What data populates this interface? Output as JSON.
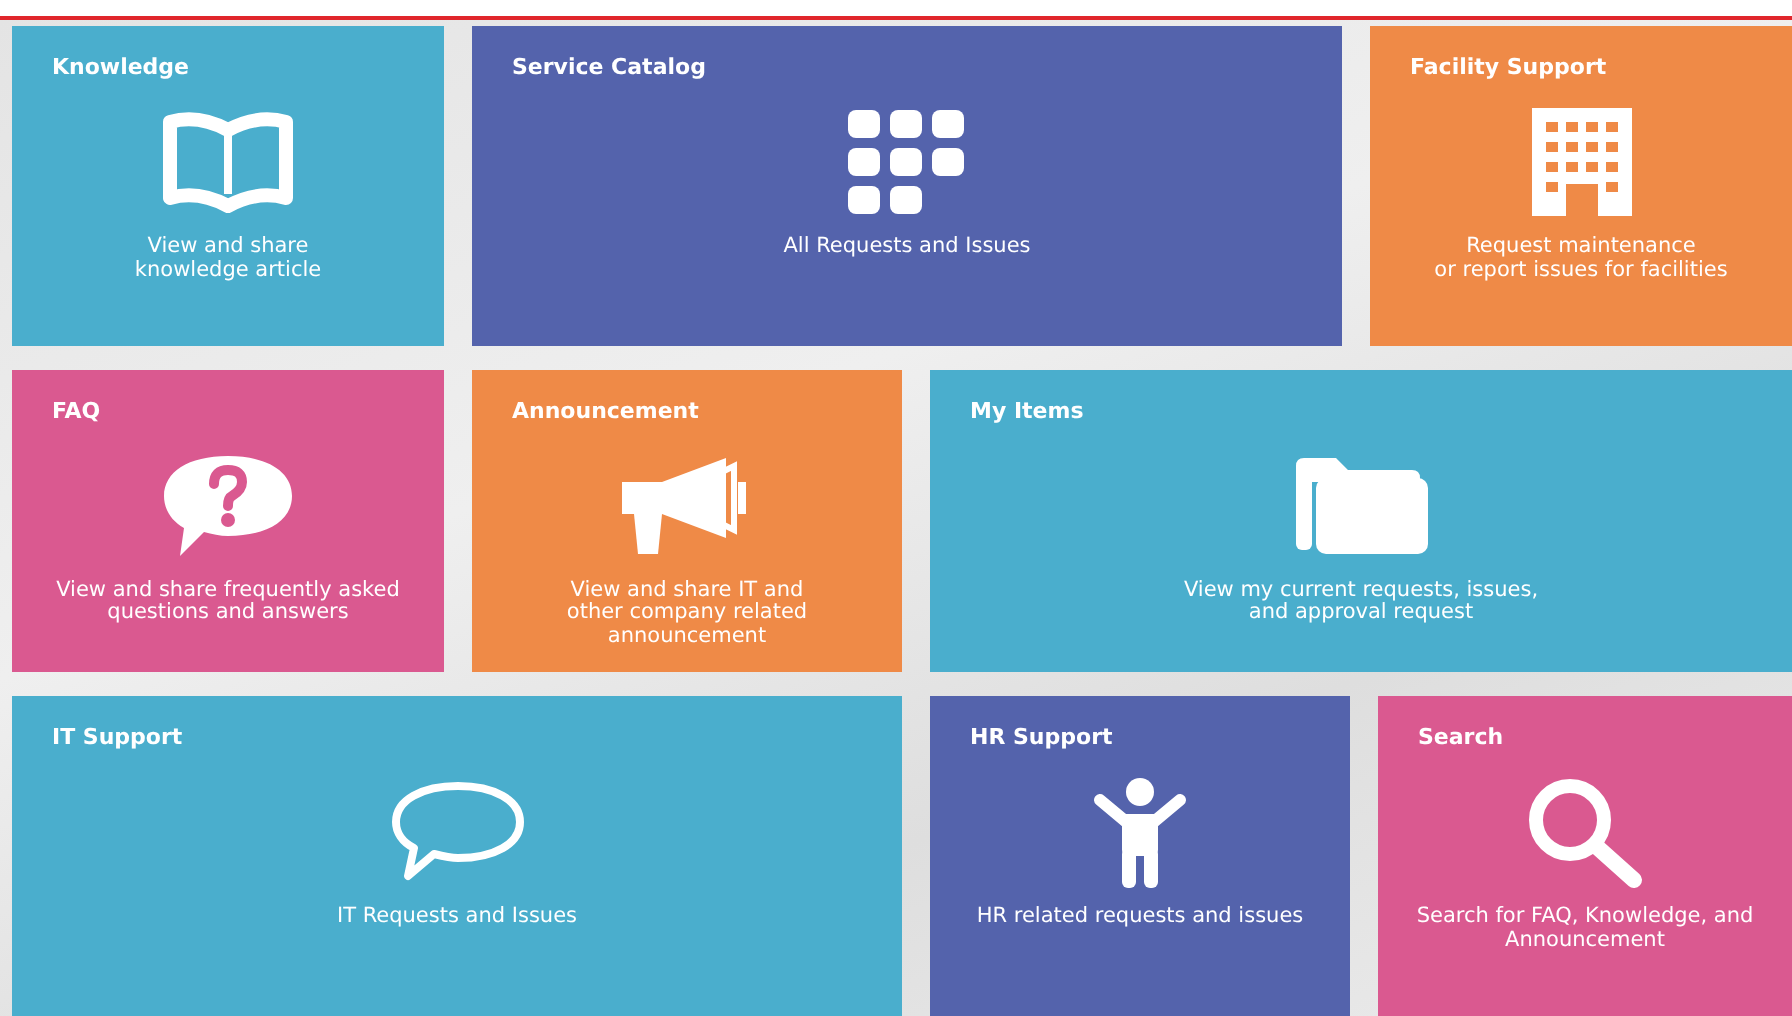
{
  "rows": [
    {
      "tiles": [
        {
          "title": "Knowledge",
          "description": "View and share\nknowledge article",
          "kind": "book",
          "color": "#4aaecd"
        },
        {
          "title": "Service Catalog",
          "description": "All Requests and Issues",
          "kind": "grid",
          "color": "#5463ac"
        },
        {
          "title": "Facility Support",
          "description": "Request maintenance\nor report issues for facilities",
          "kind": "building",
          "color": "#ef8a47"
        }
      ]
    },
    {
      "tiles": [
        {
          "title": "FAQ",
          "description": "View and share frequently asked\nquestions and answers",
          "kind": "question",
          "color": "#da5990"
        },
        {
          "title": "Announcement",
          "description": "View and share IT and\nother company related\nannouncement",
          "kind": "megaphone",
          "color": "#ef8a47"
        },
        {
          "title": "My Items",
          "description": "View my current requests, issues,\nand approval request",
          "kind": "folder",
          "color": "#4aaecd"
        }
      ]
    },
    {
      "tiles": [
        {
          "title": "IT Support",
          "description": "IT Requests and Issues",
          "kind": "chat",
          "color": "#4aaecd"
        },
        {
          "title": "HR Support",
          "description": "HR related requests and issues",
          "kind": "person",
          "color": "#5463ac"
        },
        {
          "title": "Search",
          "description": "Search for FAQ, Knowledge, and\nAnnouncement",
          "kind": "search",
          "color": "#da5990"
        }
      ]
    }
  ]
}
